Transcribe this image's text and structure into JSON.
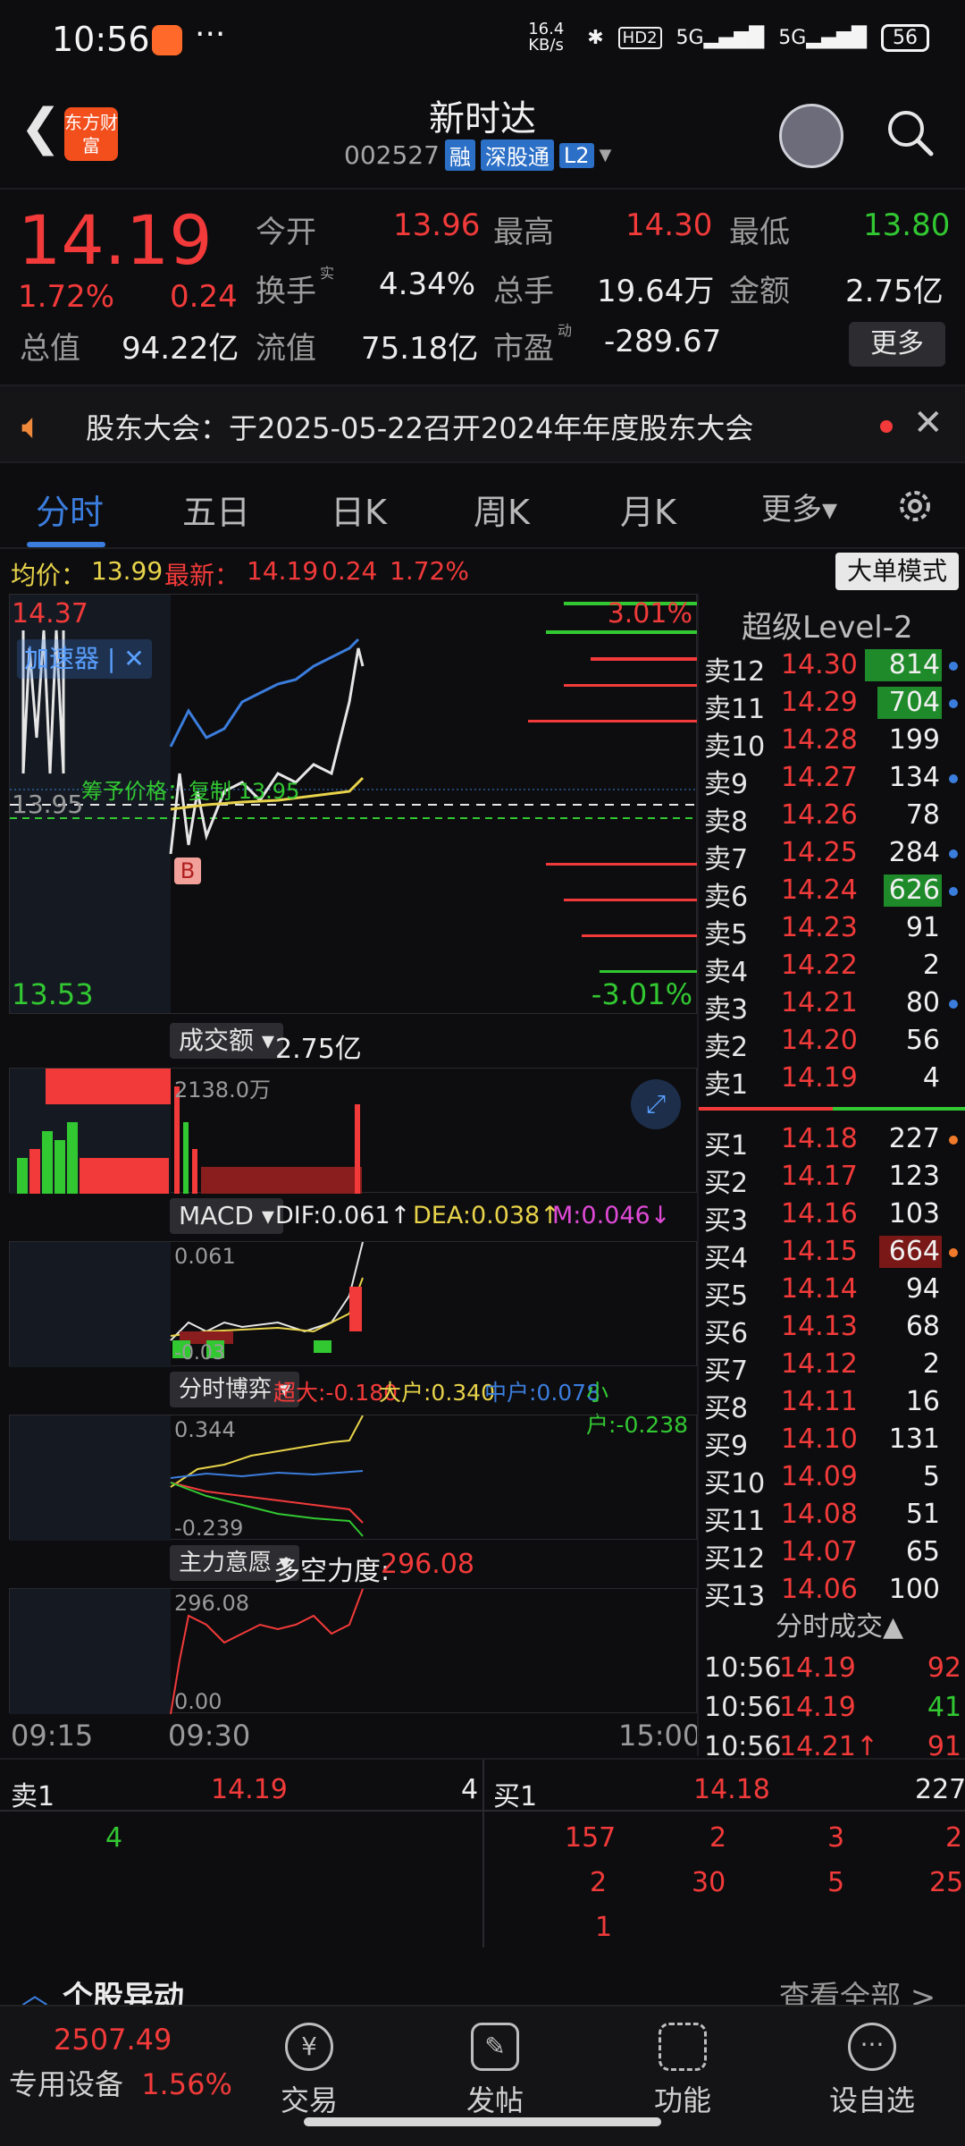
{
  "status": {
    "time": "10:56",
    "speed": "16.4 KB/s",
    "signal1": "5G",
    "signal2": "5G",
    "hd": "HD2",
    "battery": "56"
  },
  "header": {
    "title": "新时达",
    "code": "002527",
    "tags": [
      "融",
      "深股通",
      "L2"
    ],
    "logo_text": "东方财富"
  },
  "quote": {
    "price": "14.19",
    "pct": "1.72%",
    "change": "0.24",
    "open_label": "今开",
    "open": "13.96",
    "high_label": "最高",
    "high": "14.30",
    "low_label": "最低",
    "low": "13.80",
    "turnover_label": "换手",
    "turnover": "4.34%",
    "volume_label": "总手",
    "volume": "19.64万",
    "amount_label": "金额",
    "amount": "2.75亿",
    "mcap_label": "总值",
    "mcap": "94.22亿",
    "float_label": "流值",
    "float": "75.18亿",
    "pe_label": "市盈",
    "pe": "-289.67",
    "more": "更多"
  },
  "notice": {
    "text": "股东大会：于2025-05-22召开2024年年度股东大会"
  },
  "tabs": [
    "分时",
    "五日",
    "日K",
    "周K",
    "月K",
    "更多▾"
  ],
  "avgline": {
    "avg_label": "均价：",
    "avg": "13.99",
    "last_label": "最新：",
    "last": "14.19",
    "chg": "0.24",
    "pct": "1.72%",
    "mode": "大单模式"
  },
  "chart": {
    "top_pct": "3.01%",
    "bottom_pct": "-3.01%",
    "low_price": "13.53",
    "top_price": "14.37",
    "mid_price": "13.95",
    "accelerator": "加速器",
    "chip_label": "筹予价格：复制 13.95",
    "b_marker": "B",
    "vol_label": "成交额",
    "vol_value": "2.75亿",
    "vol_max": "2138.0万",
    "macd_label": "MACD",
    "dif": "DIF:0.061↑",
    "dea": "DEA:0.038↑",
    "m": "M:0.046↓",
    "macd_top": "0.061",
    "macd_bot": "-0.03",
    "game_label": "分时博弈",
    "g_super": "超大:-0.180",
    "g_big": "大户:0.340",
    "g_mid": "中户:0.078",
    "g_small": "小户:-0.238",
    "game_top": "0.344",
    "game_bot": "-0.239",
    "will_label": "主力意愿",
    "will_power_label": "多空力度:",
    "will_power": "296.08",
    "will_top": "296.08",
    "will_bot": "0.00",
    "time_start": "09:15",
    "time_open": "09:30",
    "time_end": "15:00"
  },
  "book": {
    "title": "超级Level-2",
    "asks": [
      {
        "label": "卖12",
        "price": "14.30",
        "vol": "814",
        "bar": 0.95,
        "mark": "#3b7ddd"
      },
      {
        "label": "卖11",
        "price": "14.29",
        "vol": "704",
        "bar": 0.8,
        "mark": "#3b7ddd"
      },
      {
        "label": "卖10",
        "price": "14.28",
        "vol": "199",
        "bar": 0.0,
        "mark": ""
      },
      {
        "label": "卖9",
        "price": "14.27",
        "vol": "134",
        "bar": 0.0,
        "mark": "#3b7ddd"
      },
      {
        "label": "卖8",
        "price": "14.26",
        "vol": "78",
        "bar": 0.0,
        "mark": ""
      },
      {
        "label": "卖7",
        "price": "14.25",
        "vol": "284",
        "bar": 0.0,
        "mark": "#3b7ddd"
      },
      {
        "label": "卖6",
        "price": "14.24",
        "vol": "626",
        "bar": 0.72,
        "mark": "#3b7ddd"
      },
      {
        "label": "卖5",
        "price": "14.23",
        "vol": "91",
        "bar": 0.0,
        "mark": ""
      },
      {
        "label": "卖4",
        "price": "14.22",
        "vol": "2",
        "bar": 0.0,
        "mark": ""
      },
      {
        "label": "卖3",
        "price": "14.21",
        "vol": "80",
        "bar": 0.0,
        "mark": "#3b7ddd"
      },
      {
        "label": "卖2",
        "price": "14.20",
        "vol": "56",
        "bar": 0.0,
        "mark": ""
      },
      {
        "label": "卖1",
        "price": "14.19",
        "vol": "4",
        "bar": 0.0,
        "mark": ""
      }
    ],
    "bids": [
      {
        "label": "买1",
        "price": "14.18",
        "vol": "227",
        "bar": 0.0,
        "mark": "#f07a2a"
      },
      {
        "label": "买2",
        "price": "14.17",
        "vol": "123",
        "bar": 0.0,
        "mark": ""
      },
      {
        "label": "买3",
        "price": "14.16",
        "vol": "103",
        "bar": 0.0,
        "mark": ""
      },
      {
        "label": "买4",
        "price": "14.15",
        "vol": "664",
        "bar": 0.78,
        "mark": "#f07a2a"
      },
      {
        "label": "买5",
        "price": "14.14",
        "vol": "94",
        "bar": 0.0,
        "mark": ""
      },
      {
        "label": "买6",
        "price": "14.13",
        "vol": "68",
        "bar": 0.0,
        "mark": ""
      },
      {
        "label": "买7",
        "price": "14.12",
        "vol": "2",
        "bar": 0.0,
        "mark": ""
      },
      {
        "label": "买8",
        "price": "14.11",
        "vol": "16",
        "bar": 0.0,
        "mark": ""
      },
      {
        "label": "买9",
        "price": "14.10",
        "vol": "131",
        "bar": 0.0,
        "mark": ""
      },
      {
        "label": "买10",
        "price": "14.09",
        "vol": "5",
        "bar": 0.0,
        "mark": ""
      },
      {
        "label": "买11",
        "price": "14.08",
        "vol": "51",
        "bar": 0.0,
        "mark": ""
      },
      {
        "label": "买12",
        "price": "14.07",
        "vol": "65",
        "bar": 0.0,
        "mark": ""
      },
      {
        "label": "买13",
        "price": "14.06",
        "vol": "100",
        "bar": 0.0,
        "mark": ""
      }
    ],
    "ticks_title": "分时成交▲",
    "ticks": [
      {
        "time": "10:56",
        "price": "14.19",
        "vol": "92",
        "color": "#f23a3a"
      },
      {
        "time": "10:56",
        "price": "14.19",
        "vol": "41",
        "color": "#32c832"
      },
      {
        "time": "10:56",
        "price": "14.21↑",
        "vol": "91",
        "color": "#f23a3a"
      }
    ]
  },
  "summary": {
    "sell_label": "卖1",
    "sell_price": "14.19",
    "sell_vol": "4",
    "buy_label": "买1",
    "buy_price": "14.18",
    "buy_vol": "227",
    "sell_queue": [
      "4"
    ],
    "buy_queue": [
      "157",
      "2",
      "3",
      "2",
      "2",
      "30",
      "5",
      "25",
      "1"
    ]
  },
  "moves": {
    "title": "个股异动",
    "view_all": "查看全部 >"
  },
  "nav": {
    "index_value": "2507.49",
    "index_name": "专用设备",
    "index_pct": "1.56%",
    "items": [
      "交易",
      "发帖",
      "功能",
      "设自选"
    ]
  }
}
